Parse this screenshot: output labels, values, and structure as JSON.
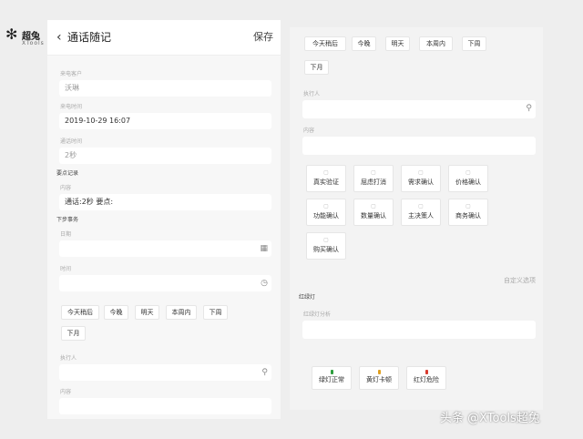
{
  "logo": {
    "cn": "超兔",
    "en": "XTools"
  },
  "left": {
    "header": {
      "title": "通话随记",
      "save_label": "保存"
    },
    "customer": {
      "label": "来电客户",
      "value": "沃琳"
    },
    "call_time": {
      "label": "来电时间",
      "value": "2019-10-29 16:07"
    },
    "duration": {
      "label": "通话时间",
      "value": "2秒"
    },
    "note_section": "要点记录",
    "content": {
      "label": "内容",
      "value": "通话:2秒  要点:"
    },
    "next_section": "下步事务",
    "date": {
      "label": "日期",
      "placeholder": ""
    },
    "time": {
      "label": "时间",
      "placeholder": ""
    },
    "quick_chips": [
      "今天稍后",
      "今晚",
      "明天",
      "本周内",
      "下周",
      "下月"
    ],
    "executor": {
      "label": "执行人"
    },
    "content2": {
      "label": "内容"
    }
  },
  "right": {
    "quick_chips": [
      "今天稍后",
      "今晚",
      "明天",
      "本周内",
      "下周",
      "下月"
    ],
    "executor": {
      "label": "执行人"
    },
    "content": {
      "label": "内容"
    },
    "tiles": [
      "真实验证",
      "屈虑打消",
      "需求确认",
      "价格确认",
      "功能确认",
      "数量确认",
      "主决策人",
      "商务确认",
      "购买确认"
    ],
    "custom_link": "自定义选项",
    "traffic_section": "红绿灯",
    "traffic_analysis": {
      "label": "红绿灯分析"
    },
    "lights": [
      {
        "label": "绿灯正常",
        "color": "#2e9e3e"
      },
      {
        "label": "黄灯卡顿",
        "color": "#e0a020"
      },
      {
        "label": "红灯危险",
        "color": "#d83a2e"
      }
    ]
  },
  "watermark": "头条 @XTools超兔"
}
